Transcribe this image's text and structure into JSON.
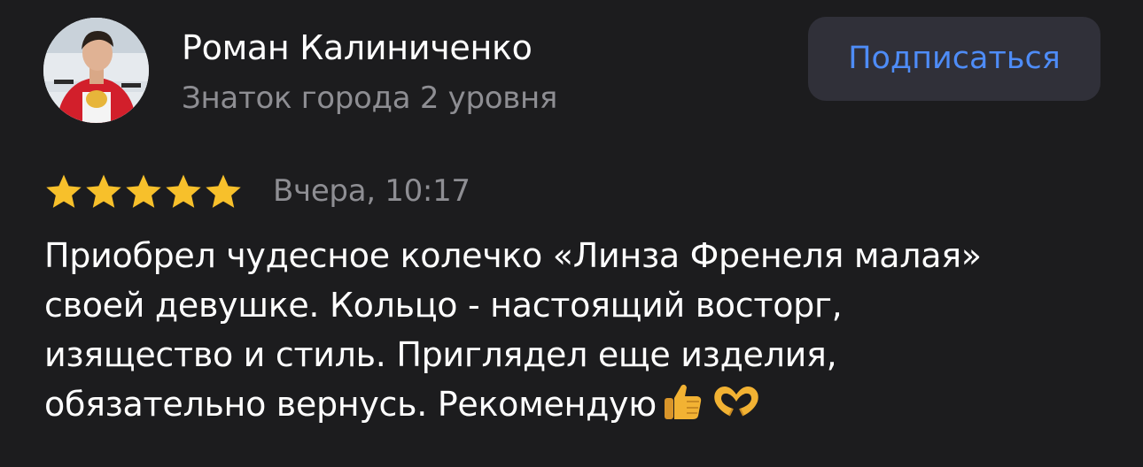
{
  "user": {
    "name": "Роман Калиниченко",
    "level": "Знаток города 2 уровня"
  },
  "subscribe": {
    "label": "Подписаться"
  },
  "review": {
    "rating": 5,
    "max_rating": 5,
    "date": "Вчера, 10:17",
    "lines": [
      "Приобрел чудесное колечко «Линза Френеля малая»",
      "своей девушке. Кольцо - настоящий восторг,",
      "изящество и стиль. Приглядел еще изделия,",
      "обязательно вернусь. Рекомендую"
    ],
    "emojis": [
      "thumbs-up-icon",
      "heart-hands-icon"
    ]
  },
  "colors": {
    "background": "#1c1c1e",
    "star": "#f7c02b",
    "accent": "#4e8cf7",
    "secondary_text": "#8e8e93"
  }
}
